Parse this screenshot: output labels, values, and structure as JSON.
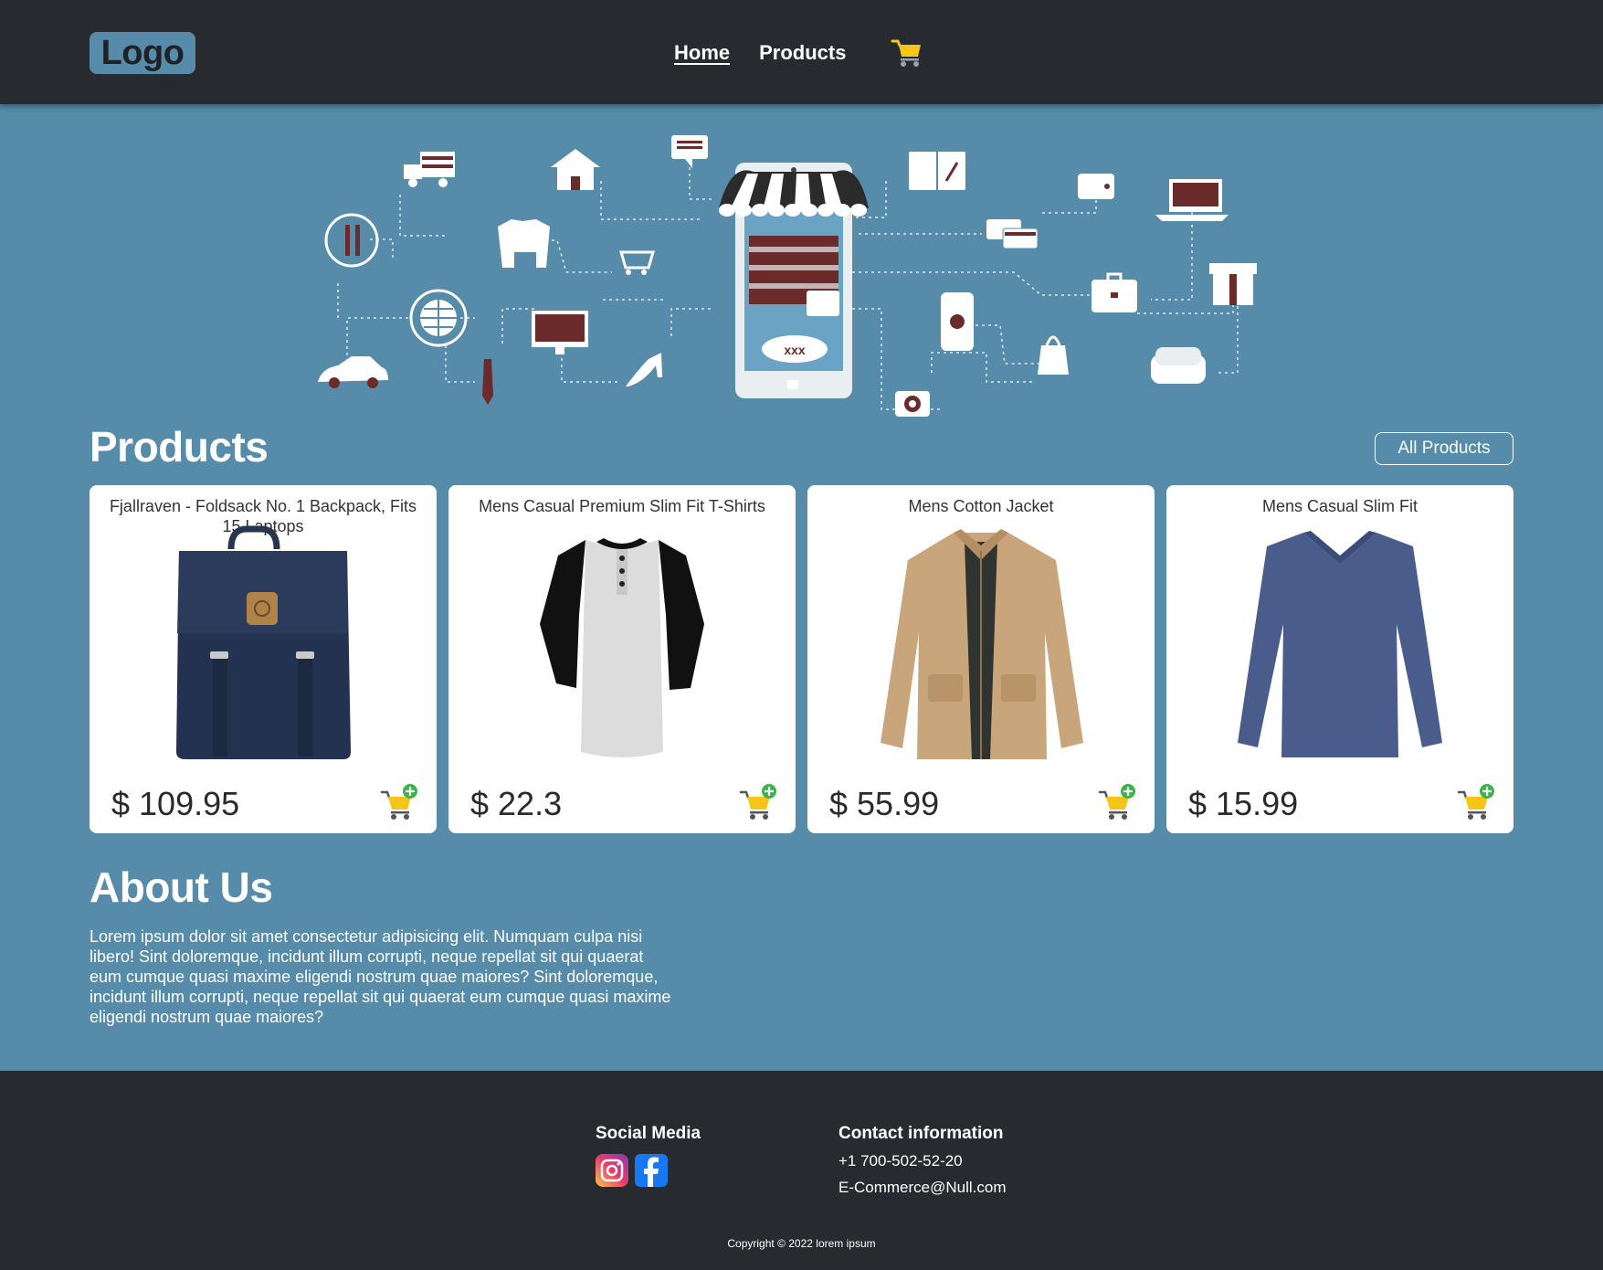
{
  "header": {
    "logo": "Logo",
    "nav": [
      {
        "label": "Home",
        "active": true
      },
      {
        "label": "Products",
        "active": false
      }
    ],
    "cart_icon": "shopping-cart-icon"
  },
  "hero": {
    "illustration": "ecommerce-shop-illustration"
  },
  "products_section": {
    "title": "Products",
    "all_button": "All Products",
    "items": [
      {
        "title": "Fjallraven - Foldsack No. 1 Backpack, Fits 15 Laptops",
        "price": "$ 109.95",
        "image": "backpack-image"
      },
      {
        "title": "Mens Casual Premium Slim Fit T-Shirts",
        "price": "$ 22.3",
        "image": "raglan-tshirt-image"
      },
      {
        "title": "Mens Cotton Jacket",
        "price": "$ 55.99",
        "image": "cotton-jacket-image"
      },
      {
        "title": "Mens Casual Slim Fit",
        "price": "$ 15.99",
        "image": "slim-fit-shirt-image"
      }
    ],
    "add_to_cart_icon": "add-to-cart-icon"
  },
  "about": {
    "title": "About Us",
    "text": "Lorem ipsum dolor sit amet consectetur adipisicing elit. Numquam culpa nisi libero! Sint doloremque, incidunt illum corrupti, neque repellat sit qui quaerat eum cumque quasi maxime eligendi nostrum quae maiores? Sint doloremque, incidunt illum corrupti, neque repellat sit qui quaerat eum cumque quasi maxime eligendi nostrum quae maiores?"
  },
  "footer": {
    "social_heading": "Social Media",
    "social_icons": [
      "instagram-icon",
      "facebook-icon"
    ],
    "contact_heading": "Contact information",
    "phone": "+1 700-502-52-20",
    "email": "E-Commerce@Null.com",
    "copyright": "Copyright © 2022 lorem ipsum"
  },
  "colors": {
    "header_bg": "#272a2e",
    "page_bg": "#568ca9",
    "card_bg": "#ffffff",
    "cart_yellow": "#f5c518",
    "plus_green": "#3bb54a"
  }
}
